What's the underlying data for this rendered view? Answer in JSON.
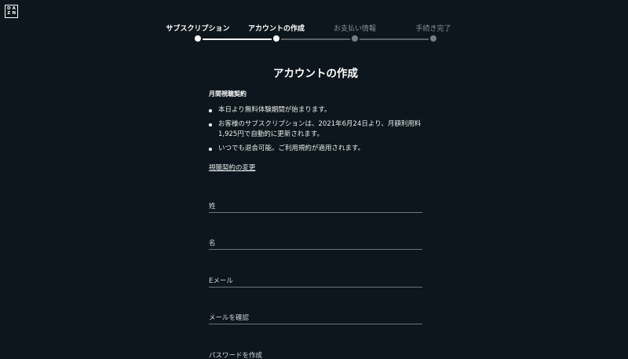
{
  "brand": {
    "logo_letters": [
      "D",
      "A",
      "Z",
      "N"
    ]
  },
  "stepper": {
    "steps": [
      {
        "label": "サブスクリプション",
        "state": "done"
      },
      {
        "label": "アカウントの作成",
        "state": "current"
      },
      {
        "label": "お支払い情報",
        "state": "pending"
      },
      {
        "label": "手続き完了",
        "state": "pending"
      }
    ]
  },
  "main": {
    "heading": "アカウントの作成",
    "plan_title": "月間視聴契約",
    "bullets": [
      "本日より無料体験期間が始まります。",
      "お客様のサブスクリプションは、2021年6月24日より、月額利用料1,925円で自動的に更新されます。",
      "いつでも退会可能。ご利用規約が適用されます。"
    ],
    "change_link": "視聴契約の変更"
  },
  "form": {
    "last_name_label": "姓",
    "first_name_label": "名",
    "email_label": "Eメール",
    "email_confirm_label": "メールを確認",
    "password_label": "パスワードを作成"
  },
  "colors": {
    "background": "#0c161c",
    "text": "#ffffff",
    "inactive": "#8a9196",
    "field_line": "#6b7378"
  }
}
